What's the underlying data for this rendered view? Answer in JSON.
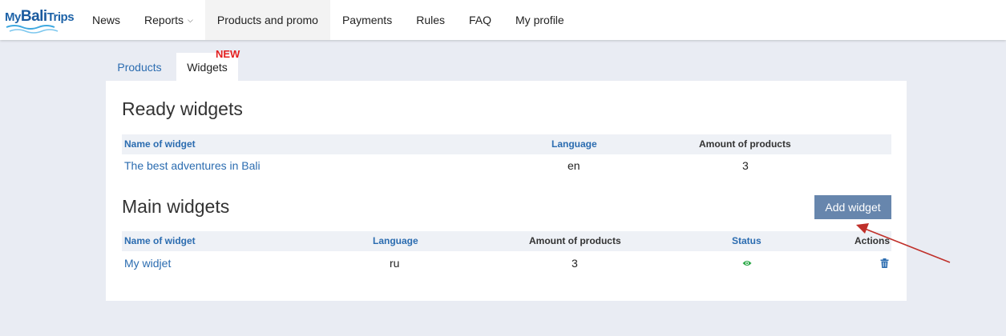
{
  "logo": {
    "part1": "My",
    "part2": "Bali",
    "part3": "Trips"
  },
  "nav": [
    {
      "label": "News"
    },
    {
      "label": "Reports"
    },
    {
      "label": "Products and promo"
    },
    {
      "label": "Payments"
    },
    {
      "label": "Rules"
    },
    {
      "label": "FAQ"
    },
    {
      "label": "My profile"
    }
  ],
  "tabs": {
    "products": "Products",
    "widgets": "Widgets",
    "badge": "NEW"
  },
  "ready": {
    "title": "Ready widgets",
    "columns": {
      "name": "Name of widget",
      "language": "Language",
      "amount": "Amount of products"
    },
    "rows": [
      {
        "name": "The best adventures in Bali",
        "language": "en",
        "amount": "3"
      }
    ]
  },
  "main": {
    "title": "Main widgets",
    "add_label": "Add widget",
    "columns": {
      "name": "Name of widget",
      "language": "Language",
      "amount": "Amount of products",
      "status": "Status",
      "actions": "Actions"
    },
    "rows": [
      {
        "name": "My widjet",
        "language": "ru",
        "amount": "3",
        "status_icon": "eye-icon",
        "action_icon": "trash-icon"
      }
    ]
  },
  "colors": {
    "accent": "#2b6cb0",
    "button": "#6786ad",
    "badge": "#e32020",
    "status": "#2eaa4a",
    "arrow": "#c0302a"
  }
}
